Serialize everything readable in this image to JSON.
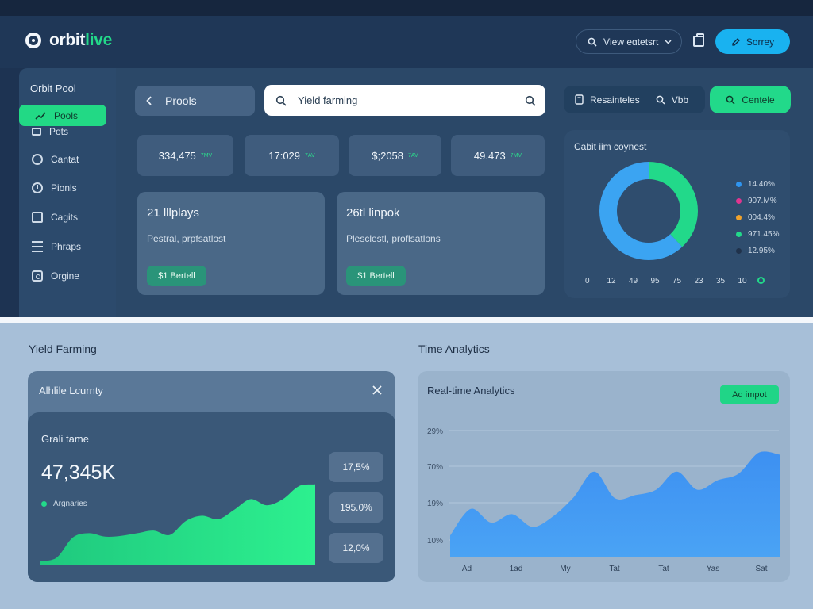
{
  "brand": {
    "name": "orbit",
    "accent": "live"
  },
  "header": {
    "view_select": "Vіew eɑtetsrt",
    "survey_label": "Sorrey"
  },
  "sidebar": {
    "title": "Orbit Pool",
    "active_label": "Pools",
    "items": [
      {
        "label": "Pots",
        "icon": "box-icon"
      },
      {
        "label": "Cantat",
        "icon": "circle-icon"
      },
      {
        "label": "Pionls",
        "icon": "clock-icon"
      },
      {
        "label": "Cagits",
        "icon": "document-icon"
      },
      {
        "label": "Phraps",
        "icon": "lines-icon"
      },
      {
        "label": "Orgine",
        "icon": "camera-icon"
      }
    ]
  },
  "toolbar": {
    "pools_label": "Prools",
    "search_value": "Yield farming",
    "resources_label": "Resainteles",
    "vub_label": "Vbb",
    "console_label": "Centele"
  },
  "stats": [
    {
      "value": "334,475",
      "tag": "7MV"
    },
    {
      "value": "17:029",
      "tag": "7AV"
    },
    {
      "value": "$;2058",
      "tag": "7AV"
    },
    {
      "value": "49.473",
      "tag": "7MV"
    }
  ],
  "cards": [
    {
      "title": "21 lllplays",
      "subtitle": "Pestral, prpfsatlost",
      "pill": "$1 Bertell"
    },
    {
      "title": "26tl linpok",
      "subtitle": "Plesclestl, proflsatlons",
      "pill": "$1 Bertell"
    }
  ],
  "donut": {
    "title": "Cabit iim coynest",
    "legend": [
      {
        "label": "14.40%",
        "color": "#2f95f0"
      },
      {
        "label": "907.M%",
        "color": "#e0358f"
      },
      {
        "label": "004.4%",
        "color": "#f0a22c"
      },
      {
        "label": "971.45%",
        "color": "#22d98a"
      },
      {
        "label": "12.95%",
        "color": "#20324b"
      }
    ],
    "axis": [
      "0",
      "12",
      "49",
      "95",
      "75",
      "23",
      "35",
      "10"
    ],
    "segments": [
      {
        "name": "green",
        "fraction": 0.38,
        "color": "#22d98a"
      },
      {
        "name": "blue",
        "fraction": 0.62,
        "color": "#3ba4f2"
      }
    ]
  },
  "yield_section": {
    "heading": "Yield Farming",
    "panel_title": "Alhlile Lcurnty",
    "label": "Grali tame",
    "big_value": "47,345K",
    "legend": "Argnaries",
    "side_stats": [
      "17,5%",
      "195.0%",
      "12,0%"
    ],
    "chart_data": {
      "type": "area",
      "x": [
        0,
        1,
        2,
        3,
        4,
        5,
        6,
        7,
        8,
        9,
        10,
        11,
        12,
        13,
        14,
        15,
        16,
        17
      ],
      "series": [
        {
          "values": [
            4,
            8,
            31,
            36,
            32,
            33,
            36,
            39,
            34,
            50,
            56,
            52,
            63,
            75,
            68,
            75,
            90,
            92
          ]
        }
      ],
      "ylim": [
        0,
        100
      ],
      "color": "#23d98a"
    }
  },
  "analytics_section": {
    "heading": "Time Analytics",
    "panel_title": "Real-time Analytics",
    "button": "Ad impot",
    "chart_data": {
      "type": "area",
      "yticks": [
        "29%",
        "70%",
        "19%",
        "10%"
      ],
      "xticks": [
        "Ad",
        "1ad",
        "My",
        "Tat",
        "Tat",
        "Yas",
        "Sat"
      ],
      "series": [
        {
          "values": [
            20,
            45,
            32,
            40,
            28,
            38,
            56,
            80,
            55,
            58,
            63,
            80,
            63,
            72,
            78,
            98,
            96
          ]
        }
      ],
      "ylim": [
        0,
        100
      ],
      "color": "#3b8ff0"
    }
  }
}
